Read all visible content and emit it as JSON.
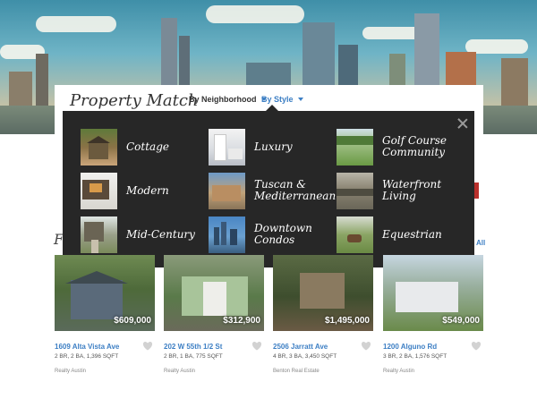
{
  "page": {
    "title": "Property Match",
    "tabs": [
      {
        "label": "By Neighborhood",
        "active": false
      },
      {
        "label": "By Style",
        "active": true
      }
    ]
  },
  "style_menu": {
    "options": [
      {
        "label_line1": "Cottage",
        "label_line2": "",
        "icon": "cottage-photo"
      },
      {
        "label_line1": "Luxury",
        "label_line2": "",
        "icon": "luxury-photo"
      },
      {
        "label_line1": "Golf Course",
        "label_line2": "Community",
        "icon": "golf-course-photo"
      },
      {
        "label_line1": "Modern",
        "label_line2": "",
        "icon": "modern-photo"
      },
      {
        "label_line1": "Tuscan &",
        "label_line2": "Mediterranean",
        "icon": "tuscan-photo"
      },
      {
        "label_line1": "Waterfront",
        "label_line2": "Living",
        "icon": "waterfront-photo"
      },
      {
        "label_line1": "Mid-Century",
        "label_line2": "",
        "icon": "mid-century-photo"
      },
      {
        "label_line1": "Downtown",
        "label_line2": "Condos",
        "icon": "downtown-photo"
      },
      {
        "label_line1": "Equestrian",
        "label_line2": "",
        "icon": "equestrian-photo"
      }
    ]
  },
  "featured": {
    "heading_partial": "Fe",
    "see_all_partial": "All"
  },
  "listings": [
    {
      "price": "$609,000",
      "address": "1609 Alta Vista Ave",
      "specs": "2 BR, 2 BA, 1,396 SQFT",
      "agency": "Realty Austin"
    },
    {
      "price": "$312,900",
      "address": "202 W 55th 1/2 St",
      "specs": "2 BR, 1 BA, 775 SQFT",
      "agency": "Realty Austin"
    },
    {
      "price": "$1,495,000",
      "address": "2506 Jarratt Ave",
      "specs": "4 BR, 3 BA, 3,450 SQFT",
      "agency": "Benton Real Estate"
    },
    {
      "price": "$549,000",
      "address": "1200 Alguno Rd",
      "specs": "3 BR, 2 BA, 1,576 SQFT",
      "agency": "Realty Austin"
    }
  ],
  "colors": {
    "accent": "#3d7fc4",
    "menu_bg": "#272727",
    "brand_red": "#b9302c"
  }
}
